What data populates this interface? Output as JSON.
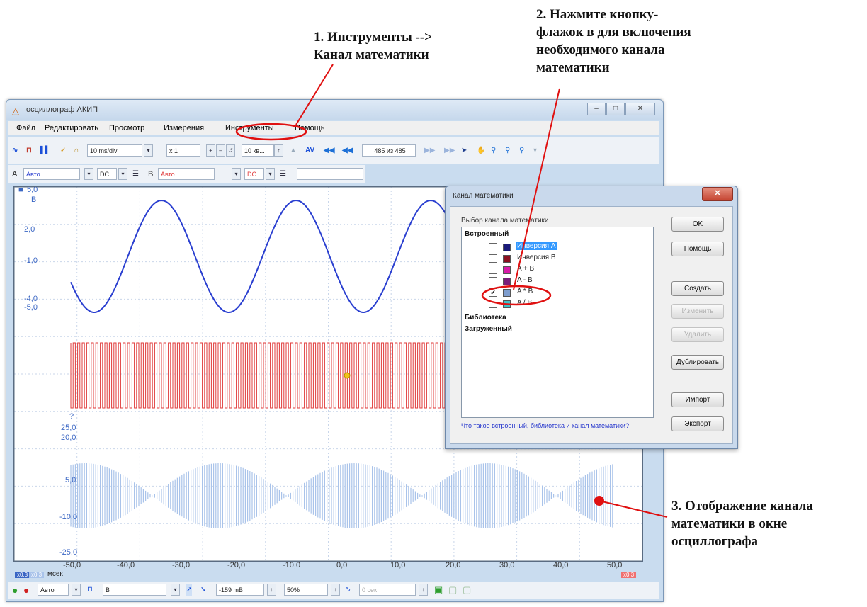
{
  "annotations": {
    "step1": "1. Инструменты -->\nКанал математики",
    "step2": "2. Нажмите кнопку-\nфлажок в для включения\nнеобходимого канала\nматематики",
    "step3": "3. Отображение канала\nматематики в окне\nосциллографа"
  },
  "window": {
    "title": "осциллограф АКИП",
    "icon": "app-logo-icon",
    "controls": [
      "minimize",
      "maximize",
      "close"
    ]
  },
  "menu": [
    "Файл",
    "Редактировать",
    "Просмотр",
    "Измерения",
    "Инструменты",
    "Помощь"
  ],
  "toolbar": {
    "timebase": "10 ms/div",
    "zoom": "x 1",
    "samples": "10 кв...",
    "buffer": "485 из 485",
    "buffer_status_colors": {
      "nav": "#1c6fd6"
    }
  },
  "channels": {
    "a_label": "A",
    "a_range": "Авто",
    "a_coupling": "DC",
    "b_label": "B",
    "b_range": "Авто",
    "b_coupling": "DC",
    "a_color": "#2a3fd0",
    "b_color": "#e03a3a",
    "math_color": "#a9c3ea"
  },
  "plot": {
    "scale_top": "5,0",
    "unit_top": "В",
    "labels_a": [
      "2,0",
      "-1,0",
      "-4,0",
      "-5,0"
    ],
    "labels_math": [
      "?",
      "25,0",
      "20,0",
      "5,0",
      "-10,0",
      "-25,0"
    ],
    "x_unit": "мсек",
    "x_ticks": [
      "-50,0",
      "-40,0",
      "-30,0",
      "-20,0",
      "-10,0",
      "0,0",
      "10,0",
      "20,0",
      "30,0",
      "40,0",
      "50,0"
    ],
    "zoom_badge_left": "x0,3",
    "zoom_badge_right": "x0,3"
  },
  "statusbar": {
    "trigger_mode": "Авто",
    "trigger_channel": "B",
    "threshold": "-159 mB",
    "percent": "50%",
    "delay": "0 сек"
  },
  "dialog": {
    "title": "Канал математики",
    "section": "Выбор канала математики",
    "groups": {
      "builtin": "Встроенный",
      "library": "Библиотека",
      "loaded": "Загруженный"
    },
    "items": [
      {
        "label": "Инверсия A",
        "checked": false,
        "selected": true,
        "color": "#1a1a7a"
      },
      {
        "label": "Инверсия B",
        "checked": false,
        "selected": false,
        "color": "#8b1020"
      },
      {
        "label": "A + B",
        "checked": false,
        "selected": false,
        "color": "#d81aa8"
      },
      {
        "label": "A - B",
        "checked": false,
        "selected": false,
        "color": "#7a1d7a"
      },
      {
        "label": "A * B",
        "checked": true,
        "selected": false,
        "color": "#7f9ecf"
      },
      {
        "label": "A / B",
        "checked": false,
        "selected": false,
        "color": "#3fc0c8"
      }
    ],
    "buttons": {
      "ok": "OK",
      "help": "Помощь",
      "create": "Создать",
      "edit": "Изменить",
      "delete": "Удалить",
      "duplicate": "Дублировать",
      "import": "Импорт",
      "export": "Экспорт"
    },
    "link": "Что такое встроенный, библиотека и канал математики?"
  }
}
